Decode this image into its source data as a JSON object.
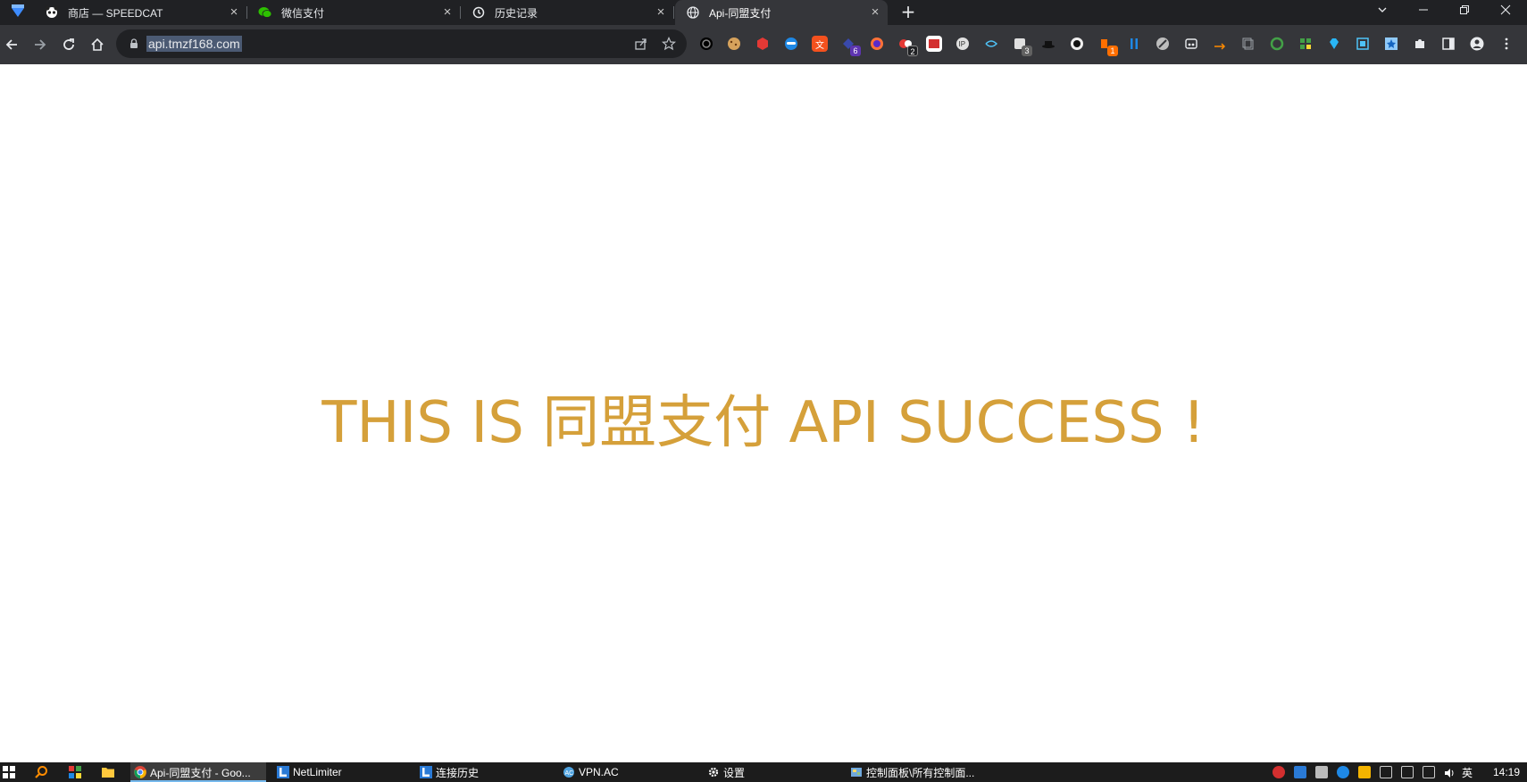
{
  "browser": {
    "tabs": [
      {
        "title": "商店 — SPEEDCAT",
        "icon": "panda-icon"
      },
      {
        "title": "微信支付",
        "icon": "wechat-icon"
      },
      {
        "title": "历史记录",
        "icon": "history-icon"
      },
      {
        "title": "Api-同盟支付",
        "icon": "globe-icon",
        "active": true
      }
    ],
    "close_glyph": "×",
    "new_tab_glyph": "+",
    "address_bar": {
      "url": "api.tmzf168.com"
    },
    "extension_badges": {
      "ext6": "6",
      "ext8": "2",
      "ext11": "3",
      "ext14": "1"
    }
  },
  "page": {
    "headline": "THIS IS 同盟支付 API SUCCESS !",
    "headline_color": "#d5a03a"
  },
  "taskbar": {
    "items": [
      {
        "label": "Api-同盟支付 - Goo...",
        "icon": "chrome-icon"
      },
      {
        "label": "NetLimiter",
        "icon": "netlimiter-icon"
      },
      {
        "label": "连接历史",
        "icon": "netlimiter-icon"
      },
      {
        "label": "VPN.AC",
        "icon": "vpn-icon"
      },
      {
        "label": "设置",
        "icon": "gear-icon"
      },
      {
        "label": "控制面板\\所有控制面...",
        "icon": "control-panel-icon"
      }
    ],
    "ime": "英",
    "clock": "14:19"
  }
}
